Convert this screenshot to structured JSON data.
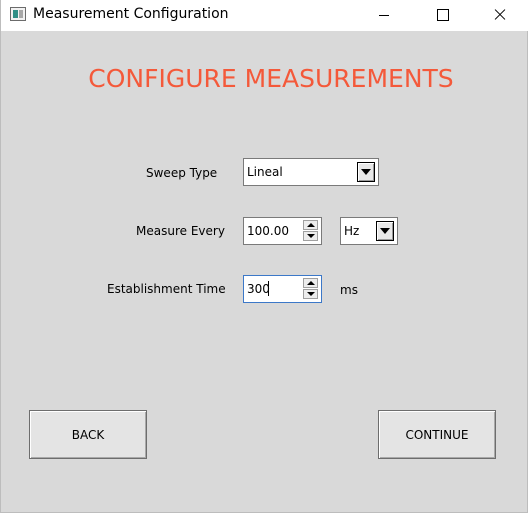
{
  "window": {
    "title": "Measurement Configuration",
    "icon": "app-window-icon",
    "controls": {
      "minimize": "minimize-icon",
      "maximize": "maximize-icon",
      "close": "close-icon"
    }
  },
  "heading": "CONFIGURE MEASUREMENTS",
  "colors": {
    "heading": "#f4593a",
    "background": "#d9d9d9",
    "focus_border": "#3c78c8"
  },
  "form": {
    "sweep_type": {
      "label": "Sweep Type",
      "value": "Lineal"
    },
    "measure_every": {
      "label": "Measure Every",
      "value": "100.00",
      "unit_value": "Hz"
    },
    "establishment_time": {
      "label": "Establishment Time",
      "value": "300",
      "unit": "ms"
    }
  },
  "buttons": {
    "back": "BACK",
    "continue": "CONTINUE"
  }
}
